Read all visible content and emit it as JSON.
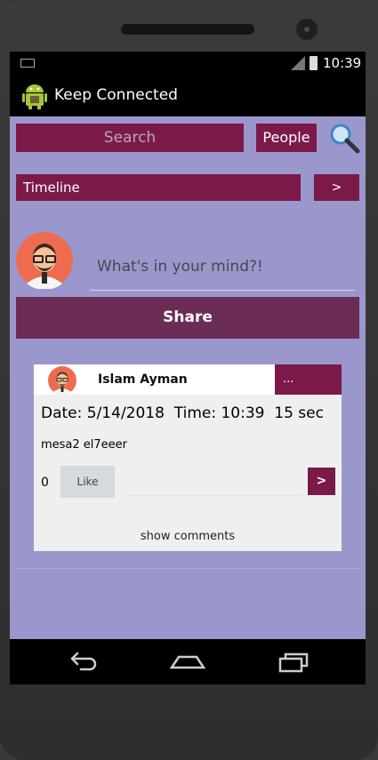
{
  "status": {
    "time": "10:39"
  },
  "app": {
    "title": "Keep Connected"
  },
  "search": {
    "placeholder": "Search",
    "people_label": "People"
  },
  "timeline": {
    "label": "Timeline",
    "next_label": ">"
  },
  "composer": {
    "placeholder": "What's in your mind?!",
    "share_label": "Share"
  },
  "post": {
    "author": "Islam Ayman",
    "menu_label": "...",
    "datetime": "Date: 5/14/2018  Time: 10:39  15 sec",
    "message": "mesa2 el7eeer",
    "like_count": "0",
    "like_label": "Like",
    "send_label": ">",
    "show_comments_label": "show comments"
  },
  "colors": {
    "accent": "#7b1a49",
    "share": "#6b2c55",
    "background": "#9a97cc"
  },
  "icons": [
    "android-logo-icon",
    "search-magnifier-icon",
    "avatar-icon",
    "back-icon",
    "home-icon",
    "recents-icon"
  ]
}
